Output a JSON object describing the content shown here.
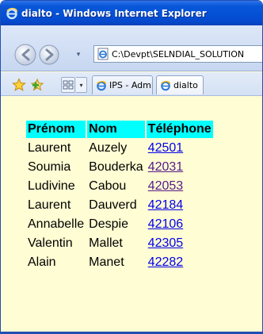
{
  "window": {
    "title": "dialto - Windows Internet Explorer"
  },
  "navigation": {
    "address": "C:\\Devpt\\SELNDIAL_SOLUTION",
    "dropdown_glyph": "▾"
  },
  "tabs": [
    {
      "label": "IPS - Admi...",
      "icon": "ie-icon"
    },
    {
      "label": "dialto",
      "icon": "ie-icon"
    }
  ],
  "quick_tabs_glyph": "▾",
  "contacts": {
    "headers": [
      "Prénom",
      "Nom",
      "Téléphone"
    ],
    "rows": [
      {
        "first": "Laurent",
        "last": "Auzely",
        "phone": "42501",
        "visited": false
      },
      {
        "first": "Soumia",
        "last": "Bouderka",
        "phone": "42031",
        "visited": true
      },
      {
        "first": "Ludivine",
        "last": "Cabou",
        "phone": "42053",
        "visited": true
      },
      {
        "first": "Laurent",
        "last": "Dauverd",
        "phone": "42184",
        "visited": false
      },
      {
        "first": "Annabelle",
        "last": "Despie",
        "phone": "42106",
        "visited": false
      },
      {
        "first": "Valentin",
        "last": "Mallet",
        "phone": "42305",
        "visited": false
      },
      {
        "first": "Alain",
        "last": "Manet",
        "phone": "42282",
        "visited": false
      }
    ]
  },
  "colors": {
    "page_background": "#fffdd3",
    "header_background": "#00ffff",
    "link": "#0000ee",
    "visited_link": "#551a8b",
    "titlebar": "#0451d6"
  }
}
